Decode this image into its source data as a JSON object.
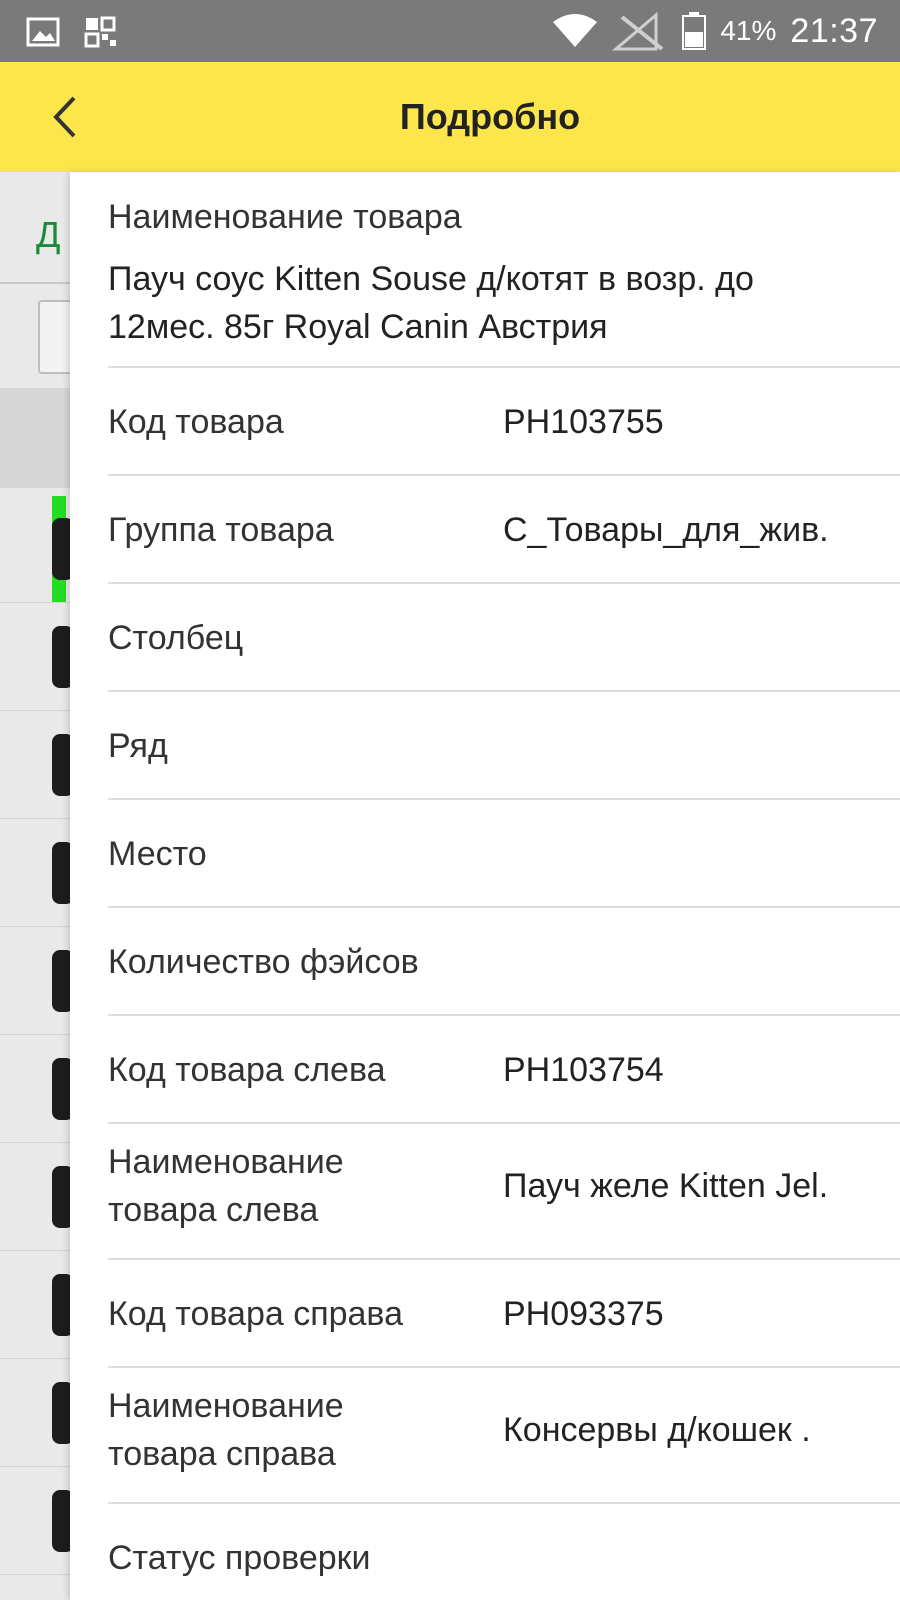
{
  "status_bar": {
    "icons": [
      "image-icon",
      "qr-notification-icon",
      "wifi-icon",
      "no-signal-icon",
      "battery-icon"
    ],
    "battery": "41%",
    "time": "21:37"
  },
  "app_bar": {
    "title": "Подробно",
    "back_icon": "chevron-left-icon",
    "color": "#fde64b"
  },
  "background": {
    "tab_letter": "Д",
    "accent_color": "#22dd22"
  },
  "details": {
    "product_name_label": "Наименование товара",
    "product_name_value": "Пауч соус Kitten Souse д/котят в возр. до",
    "product_name_value_line2": "12мес. 85г Royal Canin Австрия",
    "rows": [
      {
        "label": "Код товара",
        "value": "PH103755"
      },
      {
        "label": "Группа товара",
        "value": "С_Товары_для_жив."
      },
      {
        "label": "Столбец",
        "value": ""
      },
      {
        "label": "Ряд",
        "value": ""
      },
      {
        "label": "Место",
        "value": ""
      },
      {
        "label": "Количество фэйсов",
        "value": ""
      },
      {
        "label": "Код товара слева",
        "value": "PH103754"
      },
      {
        "label_line1": "Наименование",
        "label_line2": "товара слева",
        "value": "Пауч желе Kitten Jel."
      },
      {
        "label": "Код товара справа",
        "value": "PH093375"
      },
      {
        "label_line1": "Наименование",
        "label_line2": "товара справа",
        "value": "Консервы д/кошек ."
      },
      {
        "label": "Статус проверки",
        "value": ""
      }
    ]
  }
}
